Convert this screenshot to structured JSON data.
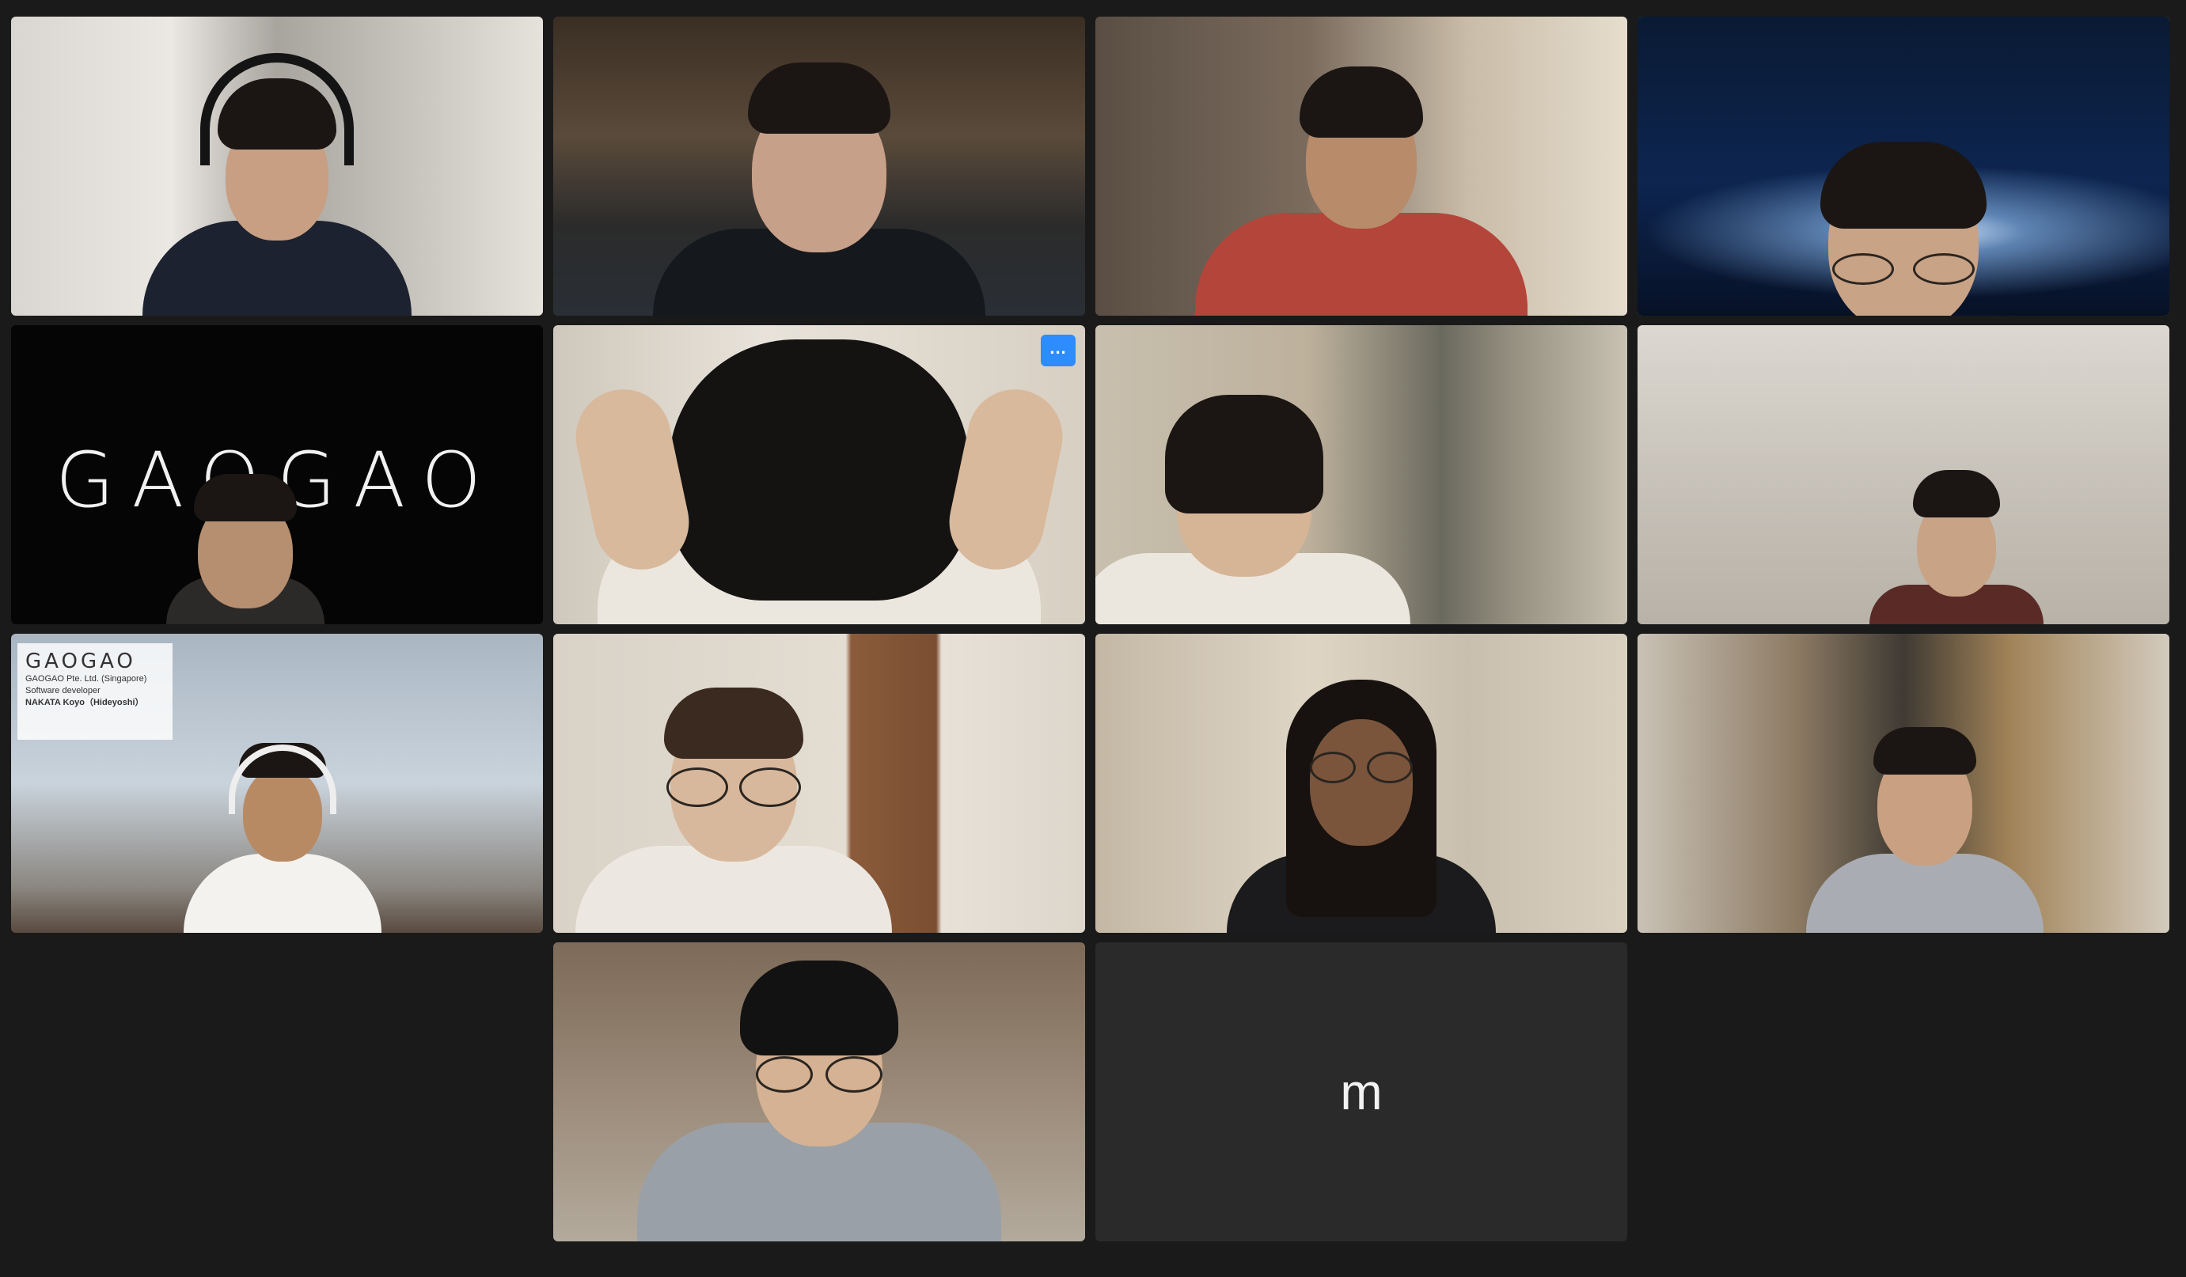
{
  "gallery": {
    "tiles": [
      {
        "id": "p1",
        "type": "video"
      },
      {
        "id": "p2",
        "type": "video"
      },
      {
        "id": "p3",
        "type": "video"
      },
      {
        "id": "p4",
        "type": "video",
        "active_speaker": true
      },
      {
        "id": "p5",
        "type": "video",
        "background_logo": "GAOGAO"
      },
      {
        "id": "p6",
        "type": "video",
        "more_button": "..."
      },
      {
        "id": "p7",
        "type": "video"
      },
      {
        "id": "p8",
        "type": "video"
      },
      {
        "id": "p9",
        "type": "video",
        "name_card": {
          "brand": "GAOGAO",
          "company": "GAOGAO Pte. Ltd. (Singapore)",
          "role": "Software developer",
          "name": "NAKATA Koyo（Hideyoshi）"
        }
      },
      {
        "id": "p10",
        "type": "video"
      },
      {
        "id": "p11",
        "type": "video"
      },
      {
        "id": "p12",
        "type": "video"
      },
      {
        "id": "p13",
        "type": "video"
      },
      {
        "id": "p14",
        "type": "avatar",
        "initial": "m"
      }
    ]
  },
  "colors": {
    "background": "#1a1a1a",
    "active_speaker_border": "#56c964",
    "more_button": "#2d8cff",
    "avatar_tile": "#2a2a2a"
  }
}
